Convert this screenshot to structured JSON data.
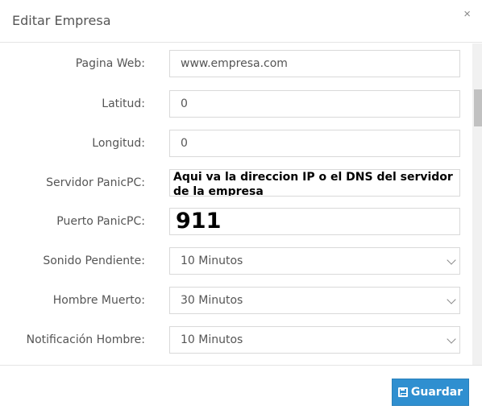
{
  "header": {
    "title": "Editar Empresa",
    "close_label": "×"
  },
  "form": {
    "pagina_web": {
      "label": "Pagina Web:",
      "value": "www.empresa.com"
    },
    "latitud": {
      "label": "Latitud:",
      "value": "0"
    },
    "longitud": {
      "label": "Longitud:",
      "value": "0"
    },
    "servidor": {
      "label": "Servidor PanicPC:",
      "value": "Aqui va la direccion IP o el DNS del servidor de la empresa"
    },
    "puerto": {
      "label": "Puerto PanicPC:",
      "value": "911"
    },
    "sonido": {
      "label": "Sonido Pendiente:",
      "value": "10 Minutos"
    },
    "hombre_muerto": {
      "label": "Hombre Muerto:",
      "value": "30 Minutos"
    },
    "notificacion": {
      "label": "Notificación Hombre:",
      "value": "10 Minutos"
    }
  },
  "footer": {
    "save_label": "Guardar",
    "save_icon": "floppy-disk-icon"
  },
  "colors": {
    "primary": "#2f8fd0"
  }
}
